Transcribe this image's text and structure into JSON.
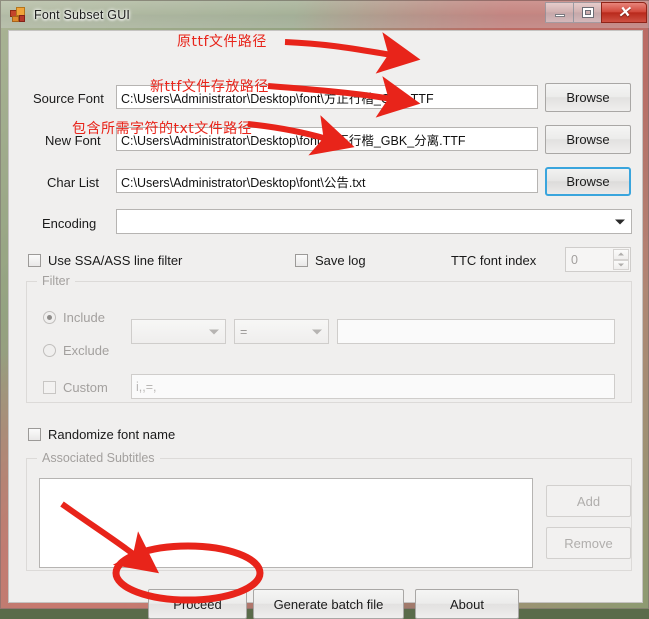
{
  "window": {
    "title": "Font Subset GUI",
    "icon": "app-icon",
    "controls": {
      "minimize": "minimize",
      "maximize": "maximize",
      "close": "✕"
    }
  },
  "form": {
    "source_font": {
      "label": "Source Font",
      "value": "C:\\Users\\Administrator\\Desktop\\font\\方正行楷_GBK.TTF",
      "browse_label": "Browse"
    },
    "new_font": {
      "label": "New Font",
      "value": "C:\\Users\\Administrator\\Desktop\\font\\方正行楷_GBK_分离.TTF",
      "browse_label": "Browse"
    },
    "char_list": {
      "label": "Char List",
      "value": "C:\\Users\\Administrator\\Desktop\\font\\公告.txt",
      "browse_label": "Browse"
    },
    "encoding": {
      "label": "Encoding",
      "value": ""
    },
    "use_ssa_filter": {
      "label": "Use SSA/ASS line filter",
      "checked": false
    },
    "save_log": {
      "label": "Save log",
      "checked": false
    },
    "ttc_font_index": {
      "label": "TTC font index",
      "value": "0"
    },
    "filter": {
      "title": "Filter",
      "include_label": "Include",
      "exclude_label": "Exclude",
      "field_value": "",
      "operator_value": "=",
      "pattern_value": "",
      "custom_label": "Custom",
      "custom_value": "i,,=,"
    },
    "randomize_font_name": {
      "label": "Randomize font name",
      "checked": false
    },
    "associated_subtitles": {
      "title": "Associated Subtitles",
      "items": [],
      "add_label": "Add",
      "remove_label": "Remove"
    },
    "actions": {
      "proceed": "Proceed",
      "generate_batch": "Generate batch file",
      "about": "About"
    }
  },
  "annotations": {
    "source_font_note": "原ttf文件路径",
    "new_font_note": "新ttf文件存放路径",
    "char_list_note": "包含所需字符的txt文件路径",
    "color": "#e8241a"
  }
}
